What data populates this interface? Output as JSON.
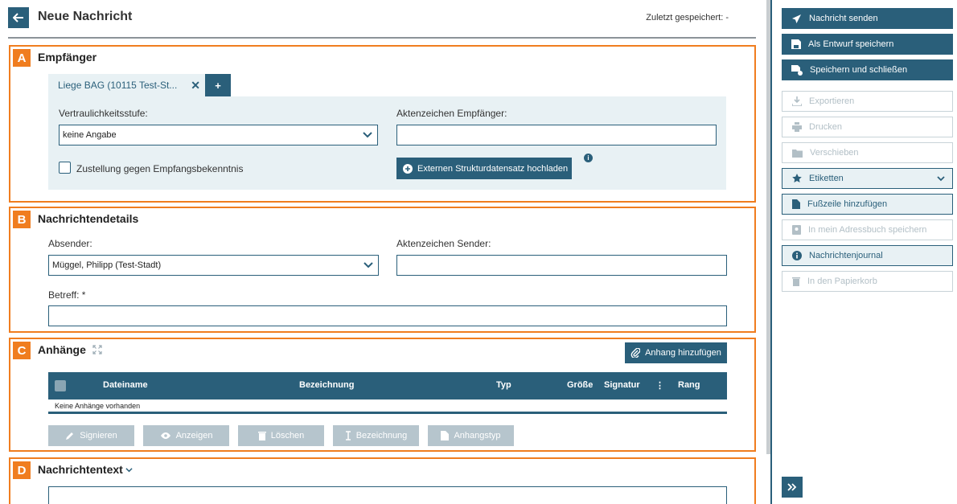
{
  "header": {
    "title": "Neue Nachricht",
    "last_saved": "Zuletzt gespeichert: -"
  },
  "sections": {
    "a": {
      "letter": "A",
      "title": "Empfänger"
    },
    "b": {
      "letter": "B",
      "title": "Nachrichtendetails"
    },
    "c": {
      "letter": "C",
      "title": "Anhänge"
    },
    "d": {
      "letter": "D",
      "title": "Nachrichtentext"
    }
  },
  "recipient": {
    "tab_label": "Liege BAG (10115 Test-St...",
    "add_label": "+",
    "confidentiality_label": "Vertraulichkeitsstufe:",
    "confidentiality_value": "keine Angabe",
    "file_ref_label": "Aktenzeichen Empfänger:",
    "file_ref_value": "",
    "delivery_label": "Zustellung gegen Empfangsbekenntnis",
    "upload_label": "Externen Strukturdatensatz hochladen",
    "info_glyph": "i"
  },
  "details": {
    "sender_label": "Absender:",
    "sender_value": "Müggel, Philipp (Test-Stadt)",
    "sender_ref_label": "Aktenzeichen Sender:",
    "sender_ref_value": "",
    "subject_label": "Betreff: *",
    "subject_value": ""
  },
  "attachments": {
    "add_label": "Anhang hinzufügen",
    "columns": {
      "filename": "Dateiname",
      "description": "Bezeichnung",
      "type": "Typ",
      "size": "Größe",
      "signature": "Signatur",
      "more": "⋮",
      "rank": "Rang"
    },
    "empty_text": "Keine Anhänge vorhanden",
    "actions": {
      "sign": "Signieren",
      "view": "Anzeigen",
      "delete": "Löschen",
      "rename": "Bezeichnung",
      "type": "Anhangstyp"
    }
  },
  "sidebar": {
    "send": "Nachricht senden",
    "draft": "Als Entwurf speichern",
    "save_close": "Speichern und schließen",
    "export": "Exportieren",
    "print": "Drucken",
    "move": "Verschieben",
    "labels": "Etiketten",
    "footer": "Fußzeile hinzufügen",
    "address_book": "In mein Adressbuch speichern",
    "journal": "Nachrichtenjournal",
    "trash": "In den Papierkorb"
  },
  "colors": {
    "primary": "#2a5f7a",
    "accent": "#f07d1f",
    "panel": "#e8f1f4",
    "disabled": "#b6c5cd"
  },
  "icons": {
    "back": "arrow-left-icon",
    "send": "paper-plane-icon",
    "draft": "floppy-disk-icon",
    "export": "download-icon",
    "print": "printer-icon",
    "move": "folder-icon",
    "labels": "star-pin-icon",
    "footer": "document-icon",
    "journal": "info-icon",
    "trash": "trash-icon",
    "expand": "expand-icon",
    "collapse": "double-chevron-right-icon"
  }
}
